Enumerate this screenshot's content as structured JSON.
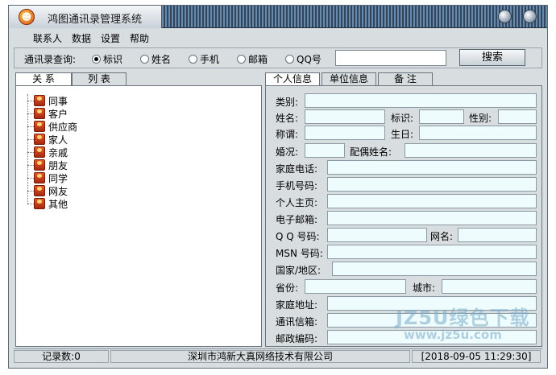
{
  "window": {
    "title": "鸿图通讯录管理系统"
  },
  "menu": [
    "联系人",
    "数据",
    "设置",
    "帮助"
  ],
  "search": {
    "label": "通讯录查询:",
    "options": [
      "标识",
      "姓名",
      "手机",
      "邮箱",
      "QQ号"
    ],
    "selected": "标识",
    "value": "",
    "button": "搜索"
  },
  "left_tabs": [
    "关 系",
    "列 表"
  ],
  "categories": [
    "同事",
    "客户",
    "供应商",
    "家人",
    "亲戚",
    "朋友",
    "同学",
    "网友",
    "其他"
  ],
  "right_tabs": [
    "个人信息",
    "单位信息",
    "备 注"
  ],
  "fields": {
    "category": "类别:",
    "name": "姓名:",
    "tag": "标识:",
    "gender": "性别:",
    "title": "称谓:",
    "birthday": "生日:",
    "marital": "婚况:",
    "spouse": "配偶姓名:",
    "home_phone": "家庭电话:",
    "mobile": "手机号码:",
    "homepage": "个人主页:",
    "email": "电子邮箱:",
    "qq": "Q Q 号码:",
    "netname": "网名:",
    "msn": "MSN 号码:",
    "region": "国家/地区:",
    "province": "省份:",
    "city": "城市:",
    "address": "家庭地址:",
    "mailbox": "通讯信箱:",
    "postcode": "邮政编码:"
  },
  "status": {
    "count": "记录数:0",
    "company": "深圳市鸿新大真网络技术有限公司",
    "datetime": "[2018-09-05 11:29:30]"
  },
  "watermark": {
    "line1": "JZ5U绿色下载",
    "line2": "www.jz5u.com"
  }
}
